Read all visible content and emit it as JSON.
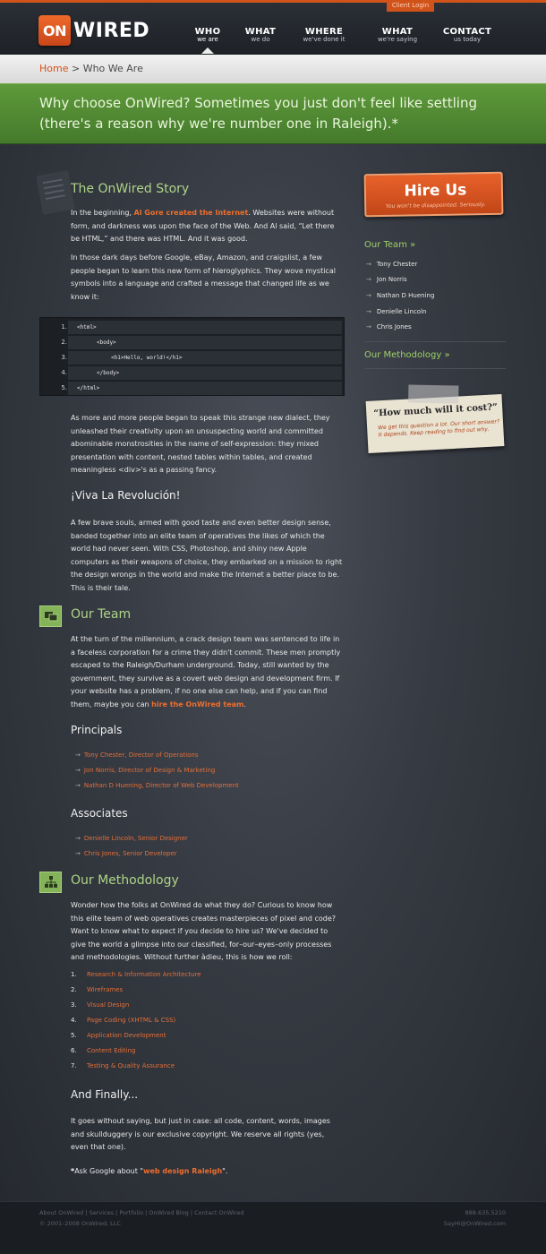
{
  "header": {
    "logo_box": "ON",
    "logo_word": "WIRED",
    "client_login": "Client Login",
    "nav": [
      {
        "title": "WHO",
        "sub": "we are"
      },
      {
        "title": "WHAT",
        "sub": "we do"
      },
      {
        "title": "WHERE",
        "sub": "we've done it"
      },
      {
        "title": "WHAT",
        "sub": "we're saying"
      },
      {
        "title": "CONTACT",
        "sub": "us today"
      }
    ]
  },
  "breadcrumb": {
    "home": "Home",
    "sep": ">",
    "current": "Who We Are"
  },
  "banner": {
    "text": "Why choose OnWired? Sometimes you just don't feel like settling (there's a reason why we're number one in Raleigh).*"
  },
  "story": {
    "heading": "The OnWired Story",
    "p1_a": "In the beginning, ",
    "p1_link": "Al Gore created the Internet",
    "p1_b": ". Websites were without form, and darkness was upon the face of the Web. And Al said, “Let there be HTML,” and there was HTML. And it was good.",
    "p2": "In those dark days before Google, eBay, Amazon, and craigslist, a few people began to learn this new form of hieroglyphics. They wove mystical symbols into a language and crafted a message that changed life as we know it:",
    "code": [
      {
        "n": "1.",
        "line": "<html>"
      },
      {
        "n": "2.",
        "line": "<body>"
      },
      {
        "n": "3.",
        "line": "<h1>Hello, world!</h1>"
      },
      {
        "n": "4.",
        "line": "</body>"
      },
      {
        "n": "5.",
        "line": "</html>"
      }
    ],
    "p3": "As more and more people began to speak this strange new dialect, they unleashed their creativity upon an unsuspecting world and committed abominable monstrosities in the name of self-expression: they mixed presentation with content, nested tables within tables, and created meaningless <div>'s as a passing fancy.",
    "sub": "¡Viva La Revolución!",
    "p4": "A few brave souls, armed with good taste and even better design sense, banded together into an elite team of operatives the likes of which the world had never seen. With CSS, Photoshop, and shiny new Apple computers as their weapons of choice, they embarked on a mission to right the design wrongs in the world and make the Internet a better place to be. This is their tale."
  },
  "team": {
    "heading": "Our Team",
    "p_a": "At the turn of the millennium, a crack design team was sentenced to life in a faceless corporation for a crime they didn't commit. These men promptly escaped to the Raleigh/Durham underground. Today, still wanted by the government, they survive as a covert web design and development firm. If your website has a problem, if no one else can help, and if you can find them, maybe you can ",
    "p_link": "hire the OnWired team",
    "p_b": ".",
    "principals_heading": "Principals",
    "principals": [
      "Tony Chester, Director of Operations",
      "Jon Norris, Director of Design & Marketing",
      "Nathan D Huening, Director of Web Development"
    ],
    "associates_heading": "Associates",
    "associates": [
      "Denielle Lincoln, Senior Designer",
      "Chris Jones, Senior Developer"
    ]
  },
  "methodology": {
    "heading": "Our Methodology",
    "p": "Wonder how the folks at OnWired do what they do? Curious to know how this elite team of web operatives creates masterpieces of pixel and code? Want to know what to expect if you decide to hire us? We've decided to give the world a glimpse into our classified, for–our–eyes–only processes and methodologies. Without further àdieu, this is how we roll:",
    "steps": [
      {
        "n": "1.",
        "label": "Research & Information Architecture"
      },
      {
        "n": "2.",
        "label": "Wireframes"
      },
      {
        "n": "3.",
        "label": "Visual Design"
      },
      {
        "n": "4.",
        "label": "Page Coding (XHTML & CSS)"
      },
      {
        "n": "5.",
        "label": "Application Development"
      },
      {
        "n": "6.",
        "label": "Content Editing"
      },
      {
        "n": "7.",
        "label": "Testing & Quality Assurance"
      }
    ]
  },
  "finally": {
    "heading": "And Finally...",
    "p": "It goes without saying, but just in case: all code, content, words, images and skullduggery is our exclusive copyright. We reserve all rights (yes, even that one)."
  },
  "footnote": {
    "star": "*",
    "text": "Ask Google about \"",
    "link": "web design Raleigh",
    "end": "\"."
  },
  "sidebar": {
    "hire_title": "Hire Us",
    "hire_sub": "You won't be disappointed. Seriously.",
    "team_heading": "Our Team »",
    "team": [
      "Tony Chester",
      "Jon Norris",
      "Nathan D Huening",
      "Denielle Lincoln",
      "Chris Jones"
    ],
    "method_heading": "Our Methodology »",
    "note_q": "“How much will it cost?”",
    "note_a": "We get this question a lot. Our short answer? It depends. Keep reading to find out why."
  },
  "footer": {
    "links": "About OnWired | Services | Portfolio | OnWired Blog | Contact OnWired",
    "copy": "© 2001–2008 OnWired, LLC",
    "phone": "888.635.5210",
    "email": "SayHi@OnWired.com"
  },
  "colors": {
    "accent": "#d2531a",
    "green": "#5f9a3b",
    "link": "#ee6e2d"
  }
}
